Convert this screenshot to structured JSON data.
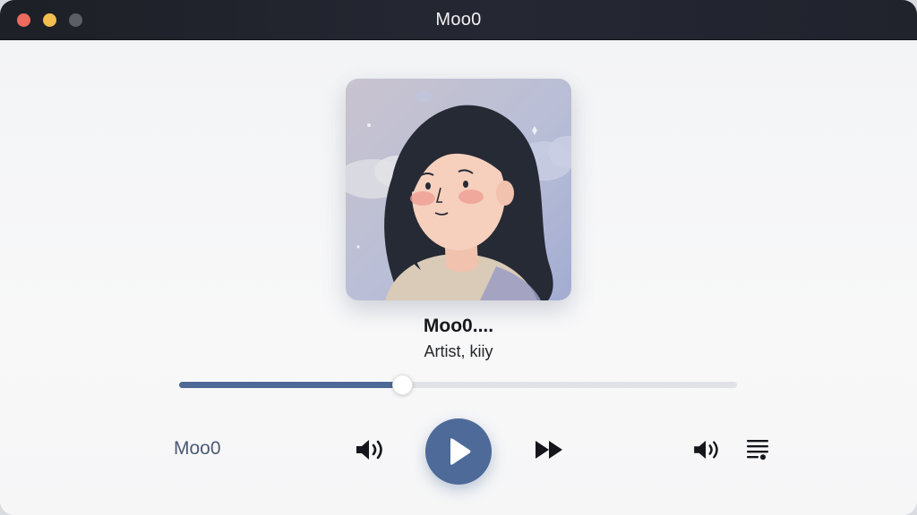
{
  "window": {
    "title": "Moo0",
    "traffic_lights": {
      "close": "#ec6a5f",
      "minimize": "#f3bd4f",
      "maximize": "#5c5e66"
    }
  },
  "artwork": {
    "description_icon": "album-art-illustration"
  },
  "track": {
    "title": "Moo0....",
    "artist": "Artist, kiiy"
  },
  "progress": {
    "fraction": 0.4,
    "fill_color": "#4e6996"
  },
  "controls": {
    "app_label": "Moo0",
    "icons": [
      "volume-icon",
      "play-icon",
      "fast-forward-icon",
      "volume-icon",
      "queue-icon"
    ],
    "accent": "#4d6a99"
  }
}
